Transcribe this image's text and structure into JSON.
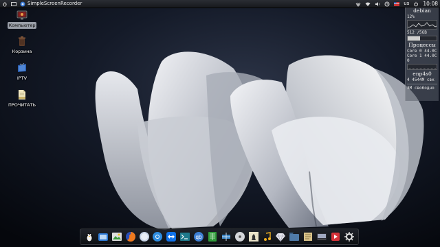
{
  "top_panel": {
    "task_title": "SimpleScreenRecorder",
    "keyboard_layout": "us",
    "clock": "10:08",
    "icons": [
      "menu-icon",
      "screen-recorder-icon",
      "network-icon",
      "volume-icon",
      "updates-icon",
      "flag-icon"
    ]
  },
  "desktop_icons": [
    {
      "label": "Компьютер",
      "icon": "computer-icon",
      "selected": true
    },
    {
      "label": "Корзина",
      "icon": "trash-icon",
      "selected": false
    },
    {
      "label": "IPTV",
      "icon": "iptv-icon",
      "selected": false
    },
    {
      "label": "ПРОЧИТАТЬ",
      "icon": "text-file-icon",
      "selected": false
    }
  ],
  "conky": {
    "hostname": "debian",
    "cpu_label": "12%",
    "mem_label": "512 /5GB",
    "processes_title": "Процессы",
    "core0": "Core 0 44.0C",
    "core1": "Core 1 44.0C",
    "zero": "0",
    "net_title": "enp4s0",
    "net_value": "4 4544M свк",
    "disk_free": "3M свободно"
  },
  "dock": {
    "items": [
      "linux-tux-icon",
      "files-icon",
      "image-viewer-icon",
      "firefox-icon",
      "blank-app-icon",
      "web-browser-icon",
      "teamviewer-icon",
      "terminal-icon",
      "qbittorrent-icon",
      "spreadsheet-icon",
      "network-tool-icon",
      "disc-burner-icon",
      "chess-icon",
      "music-note-icon",
      "ruby-icon",
      "folder-icon",
      "text-editor-icon",
      "media-player-icon",
      "video-player-icon",
      "settings-gear-icon"
    ]
  },
  "colors": {
    "panel_bg": "#1e2024",
    "dock_bg": "#1b1d22",
    "wallpaper_dark": "#0a0e18",
    "petal": "#d9dbe0"
  }
}
